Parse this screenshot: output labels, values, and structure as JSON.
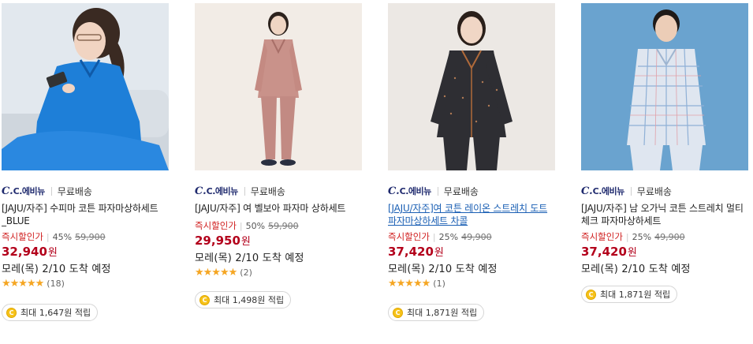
{
  "products": [
    {
      "seller_logo": "C.에비뉴",
      "shipping": "무료배송",
      "title": "[JAJU/자주] 수피마 코튼 파자마상하세트_BLUE",
      "discount_label": "즉시할인가",
      "discount_rate": "45%",
      "original_price": "59,900",
      "price": "32,940",
      "currency": "원",
      "delivery": "모레(목) 2/10 도착 예정",
      "rating_stars": "★★★★★",
      "rating_value": 4.5,
      "review_count": "(18)",
      "points": "최대 1,647원 적립",
      "image_bg": "#dfe6ee",
      "garment_color": "#1e7fd8"
    },
    {
      "seller_logo": "C.에비뉴",
      "shipping": "무료배송",
      "title": "[JAJU/자주] 여 벨보아 파자마 상하세트",
      "discount_label": "즉시할인가",
      "discount_rate": "50%",
      "original_price": "59,900",
      "price": "29,950",
      "currency": "원",
      "delivery": "모레(목) 2/10 도착 예정",
      "rating_stars": "★★★★★",
      "rating_value": 5,
      "review_count": "(2)",
      "points": "최대 1,498원 적립",
      "image_bg": "#f1ebe5",
      "garment_color": "#c9928a"
    },
    {
      "seller_logo": "C.에비뉴",
      "shipping": "무료배송",
      "title": "[JAJU/자주]여 코튼 레이온 스트레치 도트 파자마상하세트 차콜",
      "discount_label": "즉시할인가",
      "discount_rate": "25%",
      "original_price": "49,900",
      "price": "37,420",
      "currency": "원",
      "delivery": "모레(목) 2/10 도착 예정",
      "rating_stars": "★★★★★",
      "rating_value": 5,
      "review_count": "(1)",
      "points": "최대 1,871원 적립",
      "image_bg": "#ebe7e3",
      "garment_color": "#2e2e33"
    },
    {
      "seller_logo": "C.에비뉴",
      "shipping": "무료배송",
      "title": "[JAJU/자주] 남 오가닉 코튼 스트레치 멀티체크 파자마상하세트",
      "discount_label": "즉시할인가",
      "discount_rate": "25%",
      "original_price": "49,900",
      "price": "37,420",
      "currency": "원",
      "delivery": "모레(목) 2/10 도착 예정",
      "points": "최대 1,871원 적립",
      "image_bg": "#6aa3cf",
      "garment_color": "#dfe6f0"
    }
  ]
}
